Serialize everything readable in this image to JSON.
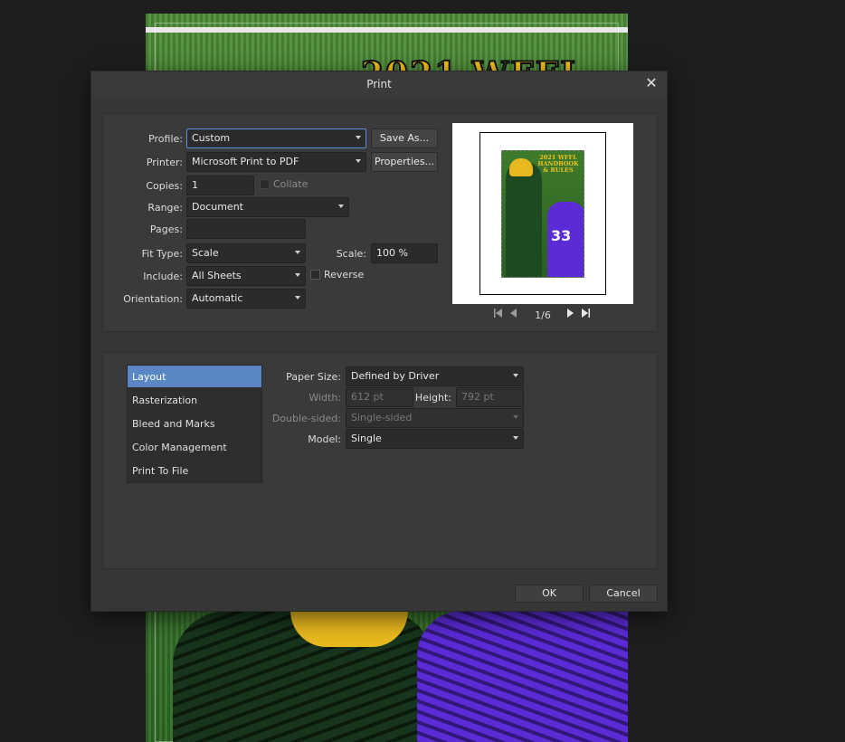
{
  "background_doc": {
    "title_peek": "2021 WFFL"
  },
  "dialog": {
    "title": "Print",
    "close_glyph": "✕"
  },
  "top": {
    "profile": {
      "label": "Profile:",
      "value": "Custom",
      "save_as": "Save As..."
    },
    "printer": {
      "label": "Printer:",
      "value": "Microsoft Print to PDF",
      "properties": "Properties..."
    },
    "copies": {
      "label": "Copies:",
      "value": "1",
      "collate": "Collate"
    },
    "range": {
      "label": "Range:",
      "value": "Document"
    },
    "pages": {
      "label": "Pages:",
      "value": ""
    },
    "fit_type": {
      "label": "Fit Type:",
      "value": "Scale"
    },
    "scale": {
      "label": "Scale:",
      "value": "100 %"
    },
    "include": {
      "label": "Include:",
      "value": "All Sheets",
      "reverse": "Reverse"
    },
    "orientation": {
      "label": "Orientation:",
      "value": "Automatic"
    },
    "preview": {
      "mini_title": "2021 WFFL HANDBOOK & RULES",
      "mini_number": "33",
      "page_indicator": "1/6"
    }
  },
  "bottom": {
    "nav": [
      {
        "label": "Layout",
        "active": true
      },
      {
        "label": "Rasterization",
        "active": false
      },
      {
        "label": "Bleed and Marks",
        "active": false
      },
      {
        "label": "Color Management",
        "active": false
      },
      {
        "label": "Print To File",
        "active": false
      }
    ],
    "paper_size": {
      "label": "Paper Size:",
      "value": "Defined by Driver"
    },
    "width": {
      "label": "Width:",
      "value": "612 pt"
    },
    "height": {
      "label": "Height:",
      "value": "792 pt"
    },
    "double_sided": {
      "label": "Double-sided:",
      "value": "Single-sided"
    },
    "model": {
      "label": "Model:",
      "value": "Single"
    }
  },
  "footer": {
    "ok": "OK",
    "cancel": "Cancel"
  },
  "colors": {
    "accent": "#5a86c6",
    "dialog_bg": "#363636",
    "field_bg": "#2b2b2b"
  }
}
